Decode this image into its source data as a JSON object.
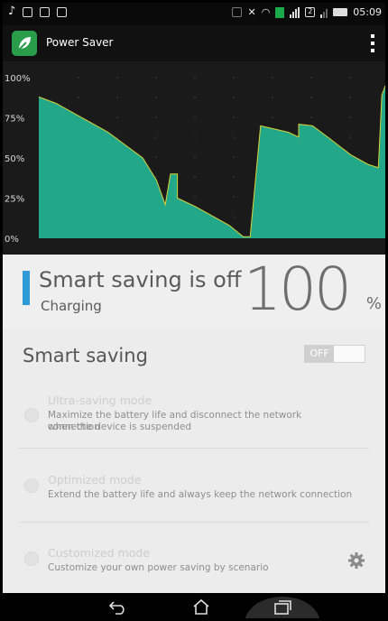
{
  "statusbar": {
    "time": "05:09",
    "sim_badge": "2"
  },
  "app": {
    "title": "Power Saver"
  },
  "chart_data": {
    "type": "area",
    "ylabel_ticks": [
      "100%",
      "75%",
      "50%",
      "25%",
      "0%"
    ],
    "ylim": [
      0,
      100
    ],
    "grid": true,
    "series": [
      {
        "values": [
          [
            0,
            88
          ],
          [
            5,
            84
          ],
          [
            10,
            78
          ],
          [
            15,
            72
          ],
          [
            20,
            66
          ],
          [
            25,
            58
          ],
          [
            30,
            50
          ],
          [
            34,
            36
          ],
          [
            36.5,
            21
          ],
          [
            38,
            40
          ],
          [
            40,
            40
          ],
          [
            40,
            25
          ],
          [
            45,
            20
          ],
          [
            50,
            14
          ],
          [
            55,
            8
          ],
          [
            59,
            1
          ],
          [
            61,
            1
          ],
          [
            64,
            70
          ],
          [
            72,
            66
          ],
          [
            75,
            63
          ],
          [
            75,
            71
          ],
          [
            79,
            70
          ],
          [
            84,
            62
          ],
          [
            90,
            52
          ],
          [
            95,
            46
          ],
          [
            98,
            44
          ],
          [
            99,
            89
          ],
          [
            100,
            95
          ]
        ]
      }
    ],
    "colors": {
      "fill": "#22a889",
      "line": "#d8d23a",
      "line_end": "#d64030"
    }
  },
  "panel": {
    "title": "Smart saving is off",
    "subtitle": "Charging",
    "percent": "100",
    "percent_symbol": "%"
  },
  "smart_saving": {
    "title": "Smart saving",
    "toggle_label": "OFF"
  },
  "options": [
    {
      "title": "Ultra-saving mode",
      "desc_line1": "Maximize the battery life and disconnect the network connection",
      "desc_line2": "when the device is suspended"
    },
    {
      "title": "Optimized mode",
      "desc_line1": "Extend the battery life and always keep the network connection"
    },
    {
      "title": "Customized mode",
      "desc_line1": "Customize your own power saving by scenario"
    }
  ],
  "colors": {
    "accent": "#2f9bd6",
    "app_green": "#2a9d4a"
  }
}
